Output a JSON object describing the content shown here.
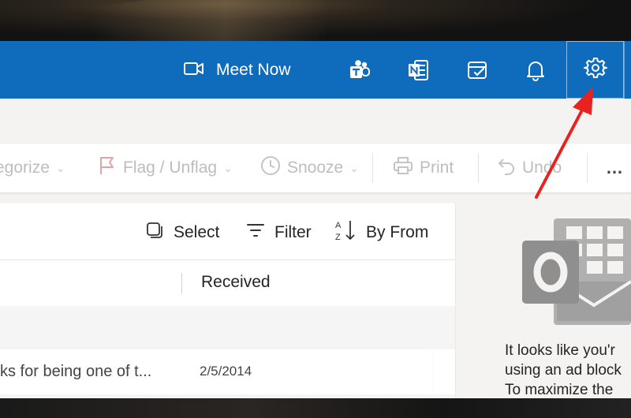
{
  "topbar": {
    "meet_now_label": "Meet Now",
    "icons": [
      "video-camera-icon",
      "teams-icon",
      "onenote-icon",
      "my-day-icon",
      "bell-icon",
      "gear-icon"
    ],
    "background": "#0f6cbd"
  },
  "toolbar": {
    "categorize_label": "egorize",
    "flag_label": "Flag / Unflag",
    "snooze_label": "Snooze",
    "print_label": "Print",
    "undo_label": "Undo",
    "more_label": "…"
  },
  "list": {
    "select_label": "Select",
    "filter_label": "Filter",
    "sort_label": "By From",
    "column_received": "Received",
    "rows": [
      {
        "snippet": "ks for being one of t...",
        "date": "2/5/2014"
      }
    ]
  },
  "reading_pane": {
    "text": "It looks like you'r\nusing an ad block\nTo maximize the"
  },
  "colors": {
    "accent": "#0f6cbd",
    "annotation_arrow": "#e8231f"
  }
}
